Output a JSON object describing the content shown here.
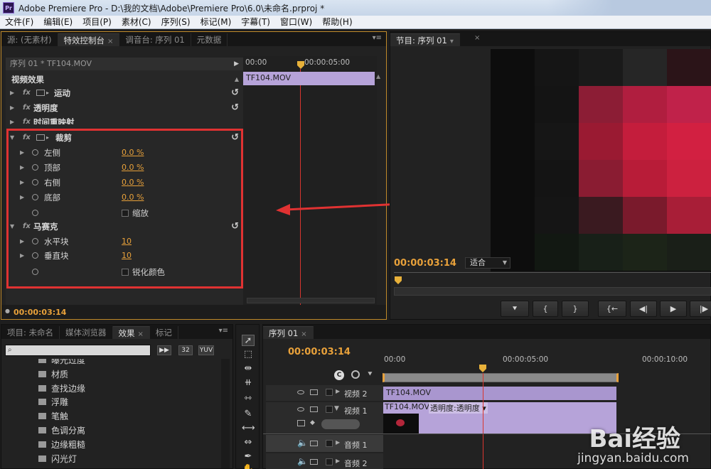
{
  "window": {
    "app_badge": "Pr",
    "title": "Adobe Premiere Pro - D:\\我的文档\\Adobe\\Premiere Pro\\6.0\\未命名.prproj *"
  },
  "menu": [
    "文件(F)",
    "编辑(E)",
    "项目(P)",
    "素材(C)",
    "序列(S)",
    "标记(M)",
    "字幕(T)",
    "窗口(W)",
    "帮助(H)"
  ],
  "effect_controls": {
    "tabs": [
      "源: (无素材)",
      "特效控制台",
      "调音台: 序列 01",
      "元数据"
    ],
    "clip_header": "序列 01 * TF104.MOV",
    "section": "视频效果",
    "clip_name": "TF104.MOV",
    "ruler": [
      "00:00",
      "00:00:05:00"
    ],
    "effects": [
      {
        "name": "运动"
      },
      {
        "name": "透明度"
      },
      {
        "name": "时间重映射"
      }
    ],
    "crop": {
      "name": "裁剪",
      "params": [
        {
          "label": "左侧",
          "value": "0.0 %"
        },
        {
          "label": "顶部",
          "value": "0.0 %"
        },
        {
          "label": "右侧",
          "value": "0.0 %"
        },
        {
          "label": "底部",
          "value": "0.0 %"
        }
      ],
      "zoom_label": "缩放"
    },
    "mosaic": {
      "name": "马赛克",
      "params": [
        {
          "label": "水平块",
          "value": "10"
        },
        {
          "label": "垂直块",
          "value": "10"
        }
      ],
      "sharpen_label": "锐化颜色"
    },
    "timecode": "00:00:03:14"
  },
  "program_monitor": {
    "tab": "节目: 序列 01",
    "timecode": "00:00:03:14",
    "fit": "适合",
    "buttons": [
      "⯆",
      "{",
      "}",
      "{←",
      "◀|",
      "▶",
      "|▶"
    ]
  },
  "project_panel": {
    "tabs": [
      "项目: 未命名",
      "媒体浏览器",
      "效果",
      "标记"
    ],
    "search_placeholder": "",
    "chips": [
      "32",
      "YUV"
    ],
    "items": [
      "曝光过度",
      "材质",
      "查找边缘",
      "浮雕",
      "笔触",
      "色调分离",
      "边缘粗糙",
      "闪光灯"
    ]
  },
  "timeline": {
    "tab": "序列 01",
    "timecode": "00:00:03:14",
    "ruler": [
      "00:00",
      "00:00:05:00",
      "00:00:10:00"
    ],
    "tracks": [
      {
        "label": "视频 2",
        "clip": "TF104.MOV"
      },
      {
        "label": "视频 1",
        "clip": "TF104.MOV",
        "effect_label": "透明度:透明度"
      },
      {
        "label": "音频 1"
      },
      {
        "label": "音频 2"
      }
    ]
  },
  "watermark": {
    "brand": "Bai经验",
    "url": "jingyan.baidu.com"
  },
  "colors": {
    "accent": "#e8a13a",
    "clip": "#b6a3d9",
    "highlight": "#e03232"
  }
}
